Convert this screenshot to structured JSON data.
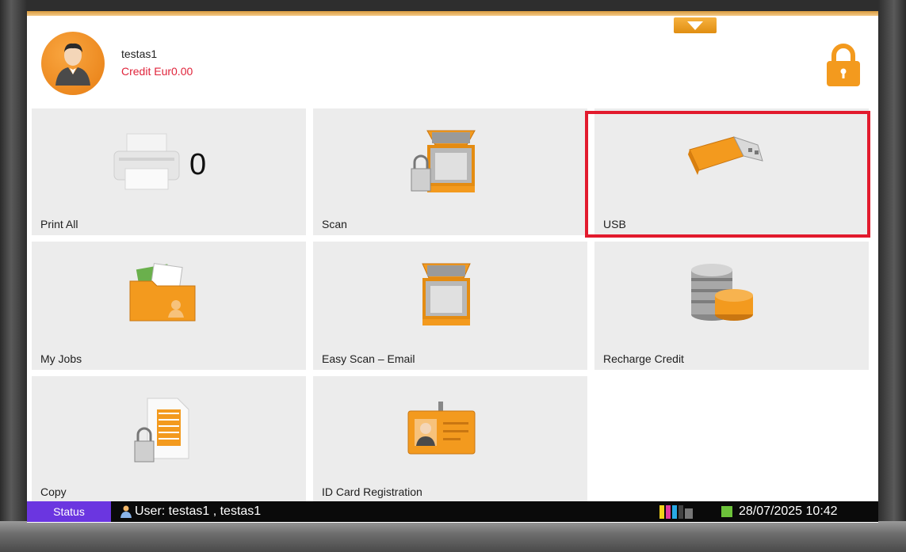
{
  "header": {
    "username": "testas1",
    "credit": "Credit Eur0.00"
  },
  "tiles": [
    {
      "label": "Print All",
      "icon": "printer-icon",
      "count": "0"
    },
    {
      "label": "Scan",
      "icon": "scanner-lock-icon"
    },
    {
      "label": "USB",
      "icon": "usb-drive-icon"
    },
    {
      "label": "My Jobs",
      "icon": "folder-icon"
    },
    {
      "label": "Easy Scan – Email",
      "icon": "scanner-icon"
    },
    {
      "label": "Recharge Credit",
      "icon": "coins-icon"
    },
    {
      "label": "Copy",
      "icon": "document-lock-icon"
    },
    {
      "label": "ID Card Registration",
      "icon": "id-card-icon"
    }
  ],
  "statusbar": {
    "status_label": "Status",
    "user_text": "User: testas1 , testas1",
    "datetime": "28/07/2025 10:42"
  },
  "colors": {
    "accent": "#f39a1e",
    "credit_text": "#e0243b",
    "highlight": "#e21a2d",
    "status_button": "#6b36e0"
  }
}
